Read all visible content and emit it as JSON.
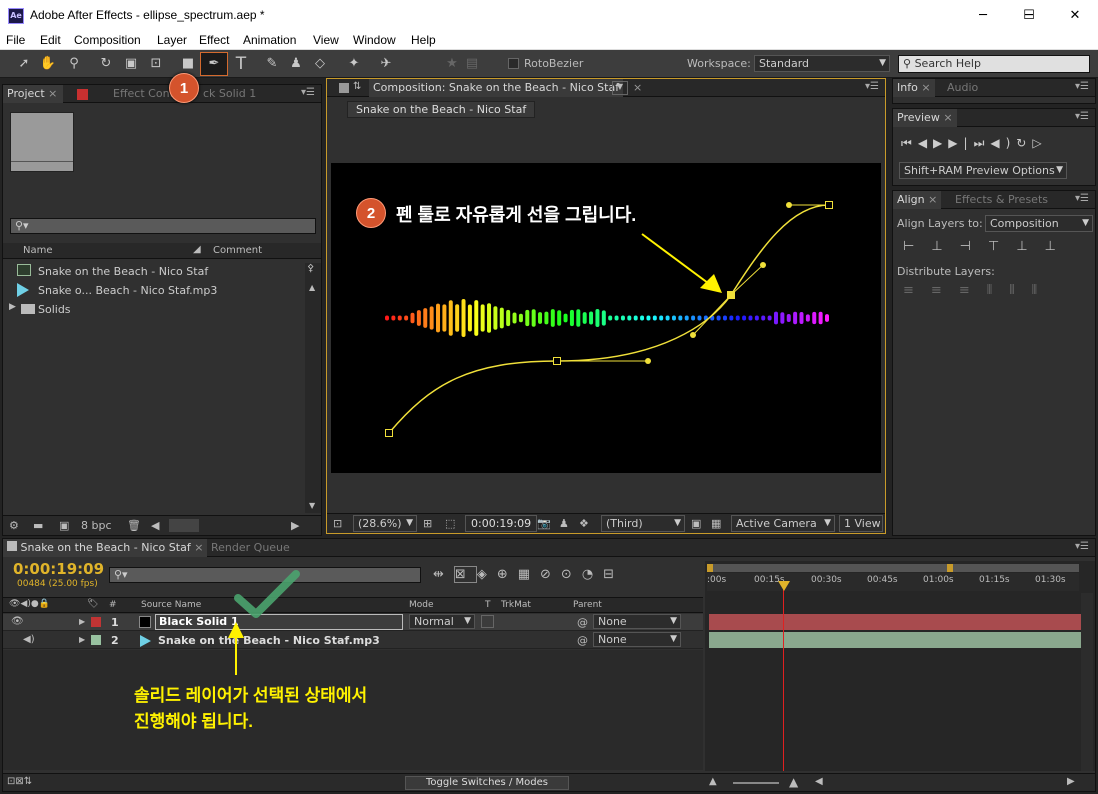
{
  "titlebar": {
    "app_icon": "Ae",
    "title": "Adobe After Effects - ellipse_spectrum.aep *",
    "minimize": "─",
    "maximize": "☐",
    "close": "✕"
  },
  "menu": [
    "File",
    "Edit",
    "Composition",
    "Layer",
    "Effect",
    "Animation",
    "View",
    "Window",
    "Help"
  ],
  "toolbar": {
    "rotobezier": "RotoBezier",
    "workspace_label": "Workspace:",
    "workspace_value": "Standard",
    "search_placeholder": "Search Help"
  },
  "annotations": {
    "badge1": "1",
    "badge2": "2",
    "step2_text": "펜 툴로 자유롭게 선을 그립니다.",
    "note_line1": "솔리드 레이어가 선택된 상태에서",
    "note_line2": "진행해야 됩니다."
  },
  "project_panel": {
    "tab_project": "Project",
    "tab_effects": "Effect Cont",
    "tab_effects_rest": "ck Solid 1",
    "col_name": "Name",
    "col_comment": "Comment",
    "items": [
      "Snake on the Beach - Nico Staf",
      "Snake o... Beach - Nico Staf.mp3",
      "Solids"
    ],
    "bpc": "8 bpc"
  },
  "comp_panel": {
    "tab": "Composition: Snake on the Beach - Nico Staf",
    "subtab": "Snake on the Beach - Nico Staf",
    "zoom": "(28.6%)",
    "timecode": "0:00:19:09",
    "resolution": "(Third)",
    "camera": "Active Camera",
    "views": "1 View"
  },
  "info_panel": {
    "tab_info": "Info",
    "tab_audio": "Audio"
  },
  "preview_panel": {
    "tab": "Preview",
    "ram_button": "Shift+RAM Preview Options"
  },
  "align_panel": {
    "tab_align": "Align",
    "tab_effects": "Effects & Presets",
    "align_to_label": "Align Layers to:",
    "align_to_value": "Composition",
    "distribute_label": "Distribute Layers:"
  },
  "timeline": {
    "tab": "Snake on the Beach - Nico Staf",
    "tab_render": "Render Queue",
    "timecode": "0:00:19:09",
    "frames": "00484 (25.00 fps)",
    "col_source": "Source Name",
    "col_mode": "Mode",
    "col_t": "T",
    "col_trkmat": "TrkMat",
    "col_parent": "Parent",
    "ticks": [
      ":00s",
      "00:15s",
      "00:30s",
      "00:45s",
      "01:00s",
      "01:15s",
      "01:30s"
    ],
    "layers": [
      {
        "num": "1",
        "name": "Black Solid 1",
        "mode": "Normal",
        "parent": "None",
        "color": "#c03434",
        "track": "#a84b4e"
      },
      {
        "num": "2",
        "name": "Snake on the Beach - Nico Staf.mp3",
        "parent": "None",
        "color": "#98c2a0",
        "track": "#8aa88e"
      }
    ],
    "toggle": "Toggle Switches / Modes"
  }
}
